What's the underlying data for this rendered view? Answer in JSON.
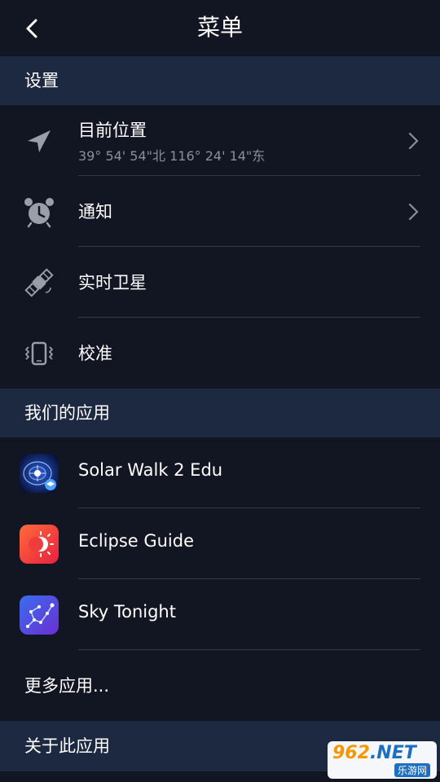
{
  "header": {
    "title": "菜单"
  },
  "sections": {
    "settings": "设置",
    "our_apps": "我们的应用",
    "about": "关于此应用"
  },
  "settings_items": {
    "location": {
      "label": "目前位置",
      "value": "39° 54' 54\"北 116° 24' 14\"东"
    },
    "notifications": {
      "label": "通知"
    },
    "satellites": {
      "label": "实时卫星"
    },
    "calibration": {
      "label": "校准"
    }
  },
  "apps": {
    "solar_walk": {
      "label": "Solar Walk 2 Edu"
    },
    "eclipse_guide": {
      "label": "Eclipse Guide"
    },
    "sky_tonight": {
      "label": "Sky Tonight"
    },
    "more": {
      "label": "更多应用..."
    }
  },
  "watermark": {
    "brand": "962",
    "tld": ".NET",
    "caption": "乐游网"
  },
  "colors": {
    "background": "#121522",
    "section_bg": "#1d2940",
    "divider": "#343947",
    "subtext": "#8a8f9a",
    "icon_gray": "#9a9ea8"
  }
}
